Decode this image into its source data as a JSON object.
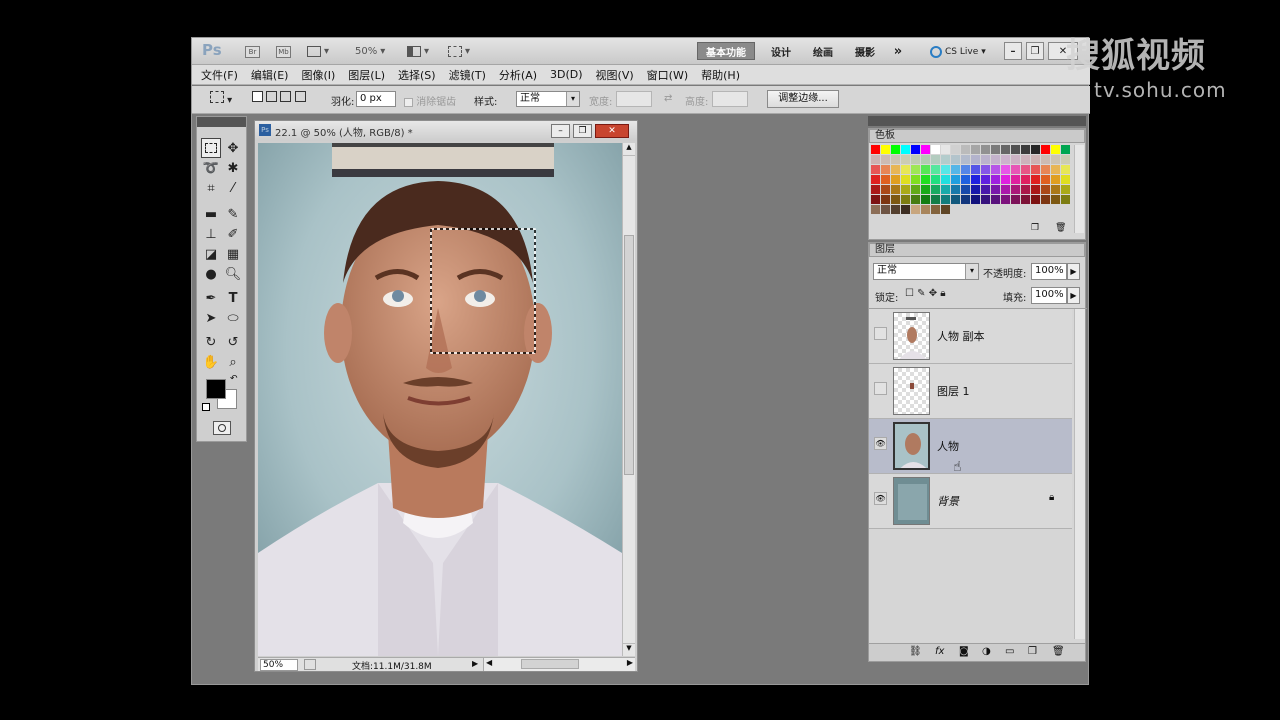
{
  "topbar": {
    "logo": "Ps",
    "zoom": "50%",
    "workspaces": [
      "基本功能",
      "设计",
      "绘画",
      "摄影"
    ],
    "cslive": "CS Live"
  },
  "menu": [
    "文件(F)",
    "编辑(E)",
    "图像(I)",
    "图层(L)",
    "选择(S)",
    "滤镜(T)",
    "分析(A)",
    "3D(D)",
    "视图(V)",
    "窗口(W)",
    "帮助(H)"
  ],
  "options": {
    "feather_label": "羽化:",
    "feather_value": "0 px",
    "antialias_label": "消除锯齿",
    "style_label": "样式:",
    "style_value": "正常",
    "width_label": "宽度:",
    "height_label": "高度:",
    "refine_edge_label": "调整边缘..."
  },
  "document": {
    "title": "22.1 @ 50% (人物, RGB/8) *",
    "zoom": "50%",
    "doc_info": "文档:11.1M/31.8M"
  },
  "swatches_panel": {
    "title": "色板"
  },
  "layers_panel": {
    "title": "图层",
    "blend_mode": "正常",
    "opacity_label": "不透明度:",
    "opacity_value": "100%",
    "lock_label": "锁定:",
    "fill_label": "填充:",
    "fill_value": "100%",
    "layers": [
      {
        "name": "人物 副本",
        "visible": false,
        "selected": false
      },
      {
        "name": "图层 1",
        "visible": false,
        "selected": false
      },
      {
        "name": "人物",
        "visible": true,
        "selected": true
      },
      {
        "name": "背景",
        "visible": true,
        "selected": false,
        "locked": true
      }
    ]
  },
  "watermark": {
    "line1": "搜狐视频",
    "line2": "tv.sohu.com"
  },
  "colors": {
    "foreground": "#000000",
    "background": "#ffffff",
    "selected_layer": "#b8bccb"
  }
}
